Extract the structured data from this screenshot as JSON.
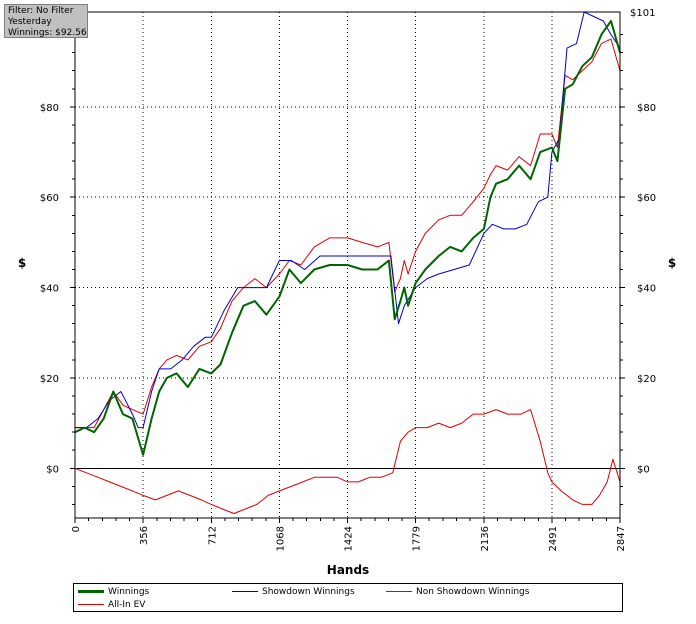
{
  "filter_box": {
    "line1": "Filter: No Filter",
    "line2": "Yesterday",
    "line3": "Winnings: $92.56"
  },
  "colors": {
    "winnings": "#006400",
    "showdown": "#0000cc",
    "nonshowdown": "#dd0000",
    "allin": "#dd0000"
  },
  "chart_data": {
    "type": "line",
    "title": "",
    "xlabel": "Hands",
    "ylabel_left": "$",
    "ylabel_right": "$",
    "xlim": [
      0,
      2847
    ],
    "ylim": [
      -11,
      101
    ],
    "x_ticks": [
      "0",
      "356",
      "712",
      "1068",
      "1424",
      "1779",
      "2136",
      "2491",
      "2847"
    ],
    "y_ticks": [
      "$0",
      "$20",
      "$40",
      "$60",
      "$80"
    ],
    "y_top_label": "$101",
    "grid": true,
    "legend_position": "bottom",
    "legend": [
      "Winnings",
      "Showdown Winnings",
      "Non Showdown Winnings",
      "All-In EV"
    ],
    "series": [
      {
        "name": "Winnings",
        "color": "#006400",
        "x": [
          0,
          50,
          100,
          150,
          200,
          250,
          300,
          356,
          400,
          440,
          480,
          530,
          590,
          650,
          712,
          760,
          820,
          880,
          940,
          1000,
          1068,
          1120,
          1180,
          1250,
          1330,
          1424,
          1500,
          1580,
          1640,
          1670,
          1700,
          1720,
          1740,
          1779,
          1830,
          1900,
          1960,
          2020,
          2080,
          2136,
          2170,
          2200,
          2260,
          2320,
          2380,
          2430,
          2491,
          2520,
          2560,
          2600,
          2650,
          2700,
          2750,
          2800,
          2847
        ],
        "y": [
          8,
          9,
          8,
          11,
          17,
          12,
          11,
          3,
          11,
          17,
          20,
          21,
          18,
          22,
          21,
          23,
          30,
          36,
          37,
          34,
          38,
          44,
          41,
          44,
          45,
          45,
          44,
          44,
          46,
          33,
          37,
          40,
          36,
          41,
          44,
          47,
          49,
          48,
          51,
          53,
          60,
          63,
          64,
          67,
          64,
          70,
          71,
          68,
          84,
          85,
          89,
          91,
          96,
          99,
          92
        ]
      },
      {
        "name": "Showdown Winnings",
        "color": "#0000cc",
        "x": [
          0,
          60,
          120,
          180,
          240,
          300,
          330,
          356,
          400,
          440,
          500,
          560,
          620,
          680,
          712,
          780,
          850,
          920,
          1000,
          1068,
          1130,
          1200,
          1280,
          1380,
          1460,
          1560,
          1650,
          1690,
          1720,
          1779,
          1840,
          1900,
          1980,
          2060,
          2136,
          2180,
          2240,
          2300,
          2360,
          2420,
          2470,
          2491,
          2530,
          2570,
          2620,
          2660,
          2710,
          2760,
          2800,
          2847
        ],
        "y": [
          9,
          9,
          11,
          15,
          17,
          12,
          9,
          9,
          17,
          22,
          22,
          24,
          27,
          29,
          29,
          35,
          40,
          40,
          40,
          46,
          46,
          44,
          47,
          47,
          47,
          47,
          47,
          32,
          36,
          40,
          42,
          43,
          44,
          45,
          52,
          54,
          53,
          53,
          54,
          59,
          60,
          70,
          73,
          93,
          94,
          101,
          100,
          99,
          96,
          93
        ]
      },
      {
        "name": "Non Showdown Winnings",
        "color": "#dd0000",
        "x": [
          0,
          60,
          120,
          180,
          240,
          300,
          356,
          420,
          480,
          540,
          600,
          660,
          712,
          770,
          830,
          890,
          950,
          1010,
          1068,
          1130,
          1190,
          1250,
          1310,
          1370,
          1424,
          1480,
          1540,
          1600,
          1660,
          1700,
          1740,
          1779,
          1840,
          1900,
          1960,
          2020,
          2080,
          2136,
          2200,
          2260,
          2330,
          2380,
          2430,
          2470,
          2491,
          2540,
          2600,
          2650,
          2700,
          2740,
          2780,
          2810,
          2847
        ],
        "y": [
          0,
          -1,
          -2,
          -3,
          -4,
          -5,
          -6,
          -7,
          -6,
          -5,
          -6,
          -7,
          -8,
          -9,
          -10,
          -9,
          -8,
          -6,
          -5,
          -4,
          -3,
          -2,
          -2,
          -2,
          -3,
          -3,
          -2,
          -2,
          -1,
          6,
          8,
          9,
          9,
          10,
          9,
          10,
          12,
          12,
          13,
          12,
          12,
          13,
          6,
          -1,
          -3,
          -5,
          -7,
          -8,
          -8,
          -6,
          -3,
          2,
          -3
        ]
      },
      {
        "name": "All-In EV",
        "color": "#dd0000",
        "x": [
          0,
          50,
          100,
          150,
          200,
          250,
          300,
          356,
          400,
          440,
          480,
          530,
          590,
          650,
          712,
          760,
          820,
          880,
          940,
          1000,
          1068,
          1120,
          1180,
          1250,
          1330,
          1424,
          1500,
          1580,
          1640,
          1670,
          1700,
          1720,
          1740,
          1779,
          1830,
          1900,
          1960,
          2020,
          2080,
          2136,
          2170,
          2200,
          2260,
          2320,
          2380,
          2430,
          2491,
          2520,
          2560,
          2600,
          2650,
          2700,
          2750,
          2800,
          2847
        ],
        "y": [
          9,
          9,
          9,
          13,
          17,
          14,
          13,
          12,
          18,
          22,
          24,
          25,
          24,
          27,
          28,
          31,
          37,
          40,
          42,
          40,
          43,
          46,
          45,
          49,
          51,
          51,
          50,
          49,
          50,
          39,
          42,
          46,
          43,
          48,
          52,
          55,
          56,
          56,
          59,
          62,
          65,
          67,
          66,
          69,
          67,
          74,
          74,
          71,
          87,
          86,
          88,
          90,
          94,
          95,
          88
        ]
      }
    ]
  }
}
